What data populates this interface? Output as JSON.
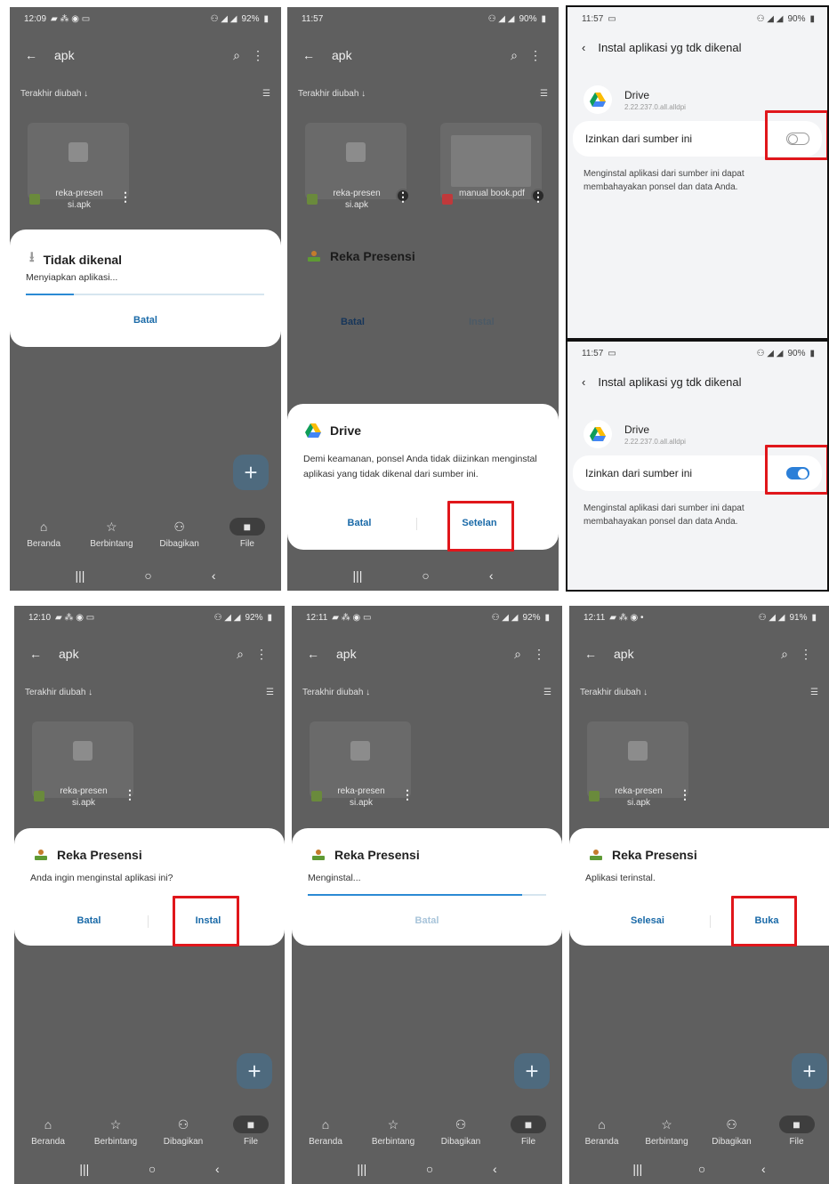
{
  "common": {
    "folder": "apk",
    "sort_label": "Terakhir diubah ↓",
    "file_apk": "reka-presen si.apk",
    "file_pdf": "manual book.pdf",
    "nav": [
      "Beranda",
      "Berbintang",
      "Dibagikan",
      "File"
    ],
    "app_name": "Reka Presensi",
    "cancel": "Batal",
    "install": "Instal"
  },
  "p1": {
    "time": "12:09",
    "battery": "92%",
    "dialog_title": "Tidak dikenal",
    "message": "Menyiapkan aplikasi...",
    "progress": 0.2,
    "cancel": "Batal"
  },
  "p2": {
    "time": "11:57",
    "battery": "90%",
    "app_title": "Reka Presensi",
    "drive_title": "Drive",
    "drive_message": "Demi keamanan, ponsel Anda tidak diizinkan menginstal aplikasi yang tidak dikenal dari sumber ini.",
    "cancel": "Batal",
    "settings": "Setelan"
  },
  "p3": {
    "top": {
      "time": "11:57",
      "battery": "90%",
      "toggle_on": false
    },
    "bottom": {
      "time": "11:57",
      "battery": "90%",
      "toggle_on": true
    },
    "header": "Instal aplikasi yg tdk dikenal",
    "app": "Drive",
    "version": "2.22.237.0.all.alldpi",
    "allow_label": "Izinkan dari sumber ini",
    "warning": "Menginstal aplikasi dari sumber ini dapat membahayakan ponsel dan data Anda."
  },
  "p4": {
    "time": "12:10",
    "battery": "92%",
    "message": "Anda ingin menginstal aplikasi ini?",
    "cancel": "Batal",
    "install": "Instal"
  },
  "p5": {
    "time": "12:11",
    "battery": "92%",
    "message": "Menginstal...",
    "progress": 0.9,
    "cancel": "Batal"
  },
  "p6": {
    "time": "12:11",
    "battery": "91%",
    "message": "Aplikasi terinstal.",
    "done": "Selesai",
    "open": "Buka"
  },
  "colors": {
    "highlight": "#e0161b",
    "accent": "#1a6aa8",
    "switch_on": "#2b7fd8"
  }
}
